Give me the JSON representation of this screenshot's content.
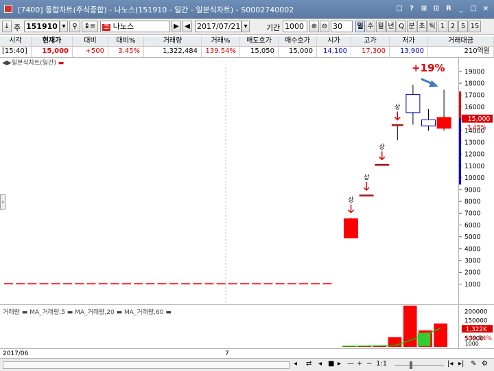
{
  "window": {
    "title": "[7400] 통합차트(주식종합) - 나노스(151910 - 일간 - 일본식차트) - S0002740002",
    "controls": [
      "□",
      "?",
      "⊞",
      "⊡",
      "R",
      "_",
      "□",
      "×"
    ]
  },
  "toolbar": {
    "code_prefix": "주",
    "stock_code": "151910",
    "market_badge": "코",
    "stock_name": "나노스",
    "date": "2017/07/21",
    "period_label": "기간",
    "period_value": "1000",
    "zoom_label": "30",
    "timeframes": [
      "일",
      "주",
      "월",
      "년",
      "Q",
      "분",
      "초",
      "틱",
      "1",
      "2",
      "5",
      "15"
    ],
    "active_timeframe": "일"
  },
  "quote": {
    "headers": [
      "시각",
      "현재가",
      "대비",
      "대비%",
      "거래량",
      "거래%",
      "매도호가",
      "매수호가",
      "시가",
      "고가",
      "저가",
      "거래대금"
    ],
    "values": [
      "[15:40]",
      "15,000",
      "+500",
      "3.45%",
      "1,322,484",
      "139.54%",
      "15,050",
      "15,000",
      "14,100",
      "17,300",
      "13,900",
      "210억원"
    ]
  },
  "chart_labels": {
    "legend": "일본식차트(일간)",
    "gain_annotation": "+19%",
    "limit_up_marker": "상",
    "current_price_tag": "15,000",
    "current_change_tag": "3.45%",
    "volume_legend": "거래량 ▬ MA_거래량,5 ▬ MA_거래량,20 ▬ MA_거래량,60 ▬",
    "volume_tag": "1,322K",
    "volume_pct_tag": "139.54%",
    "volume_unit": "1000",
    "x_start": "2017/06",
    "x_mid": "7"
  },
  "chart_data": [
    {
      "type": "candlestick",
      "title": "일본식차트(일간)",
      "ylim": [
        0,
        19500
      ],
      "y_ticks": [
        1000,
        2000,
        3000,
        4000,
        5000,
        6000,
        7000,
        8000,
        9000,
        10000,
        11000,
        12000,
        13000,
        14000,
        15000,
        16000,
        17000,
        18000,
        19000
      ],
      "flat_price": 1200,
      "flat_days": 28,
      "candles": [
        {
          "open": 5000,
          "high": 6700,
          "low": 5000,
          "close": 6600,
          "limit_up": true
        },
        {
          "open": 8560,
          "high": 8560,
          "low": 8560,
          "close": 8560,
          "limit_up": true
        },
        {
          "open": 11100,
          "high": 11100,
          "low": 11100,
          "close": 11100,
          "limit_up": true
        },
        {
          "open": 14400,
          "high": 14400,
          "low": 13100,
          "close": 14400,
          "limit_up": true
        },
        {
          "open": 15400,
          "high": 17700,
          "low": 14400,
          "close": 16900
        },
        {
          "open": 14300,
          "high": 15700,
          "low": 13900,
          "close": 14800
        },
        {
          "open": 14100,
          "high": 17300,
          "low": 13900,
          "close": 15000
        }
      ],
      "current_price": 15000,
      "gain_annotation": "+19%"
    },
    {
      "type": "bar",
      "title": "거래량",
      "series_names": [
        "거래량",
        "MA_거래량,5",
        "MA_거래량,20",
        "MA_거래량,60"
      ],
      "ylim": [
        0,
        220000
      ],
      "y_ticks": [
        50000,
        100000,
        150000,
        200000
      ],
      "values": [
        1000,
        2000,
        6000,
        55000,
        232000,
        93000,
        132000
      ],
      "current_volume": "1,322K",
      "current_volume_pct": "139.54%"
    }
  ],
  "bottom": {
    "ratio": "1:1"
  },
  "colors": {
    "up": "#ff0000",
    "down": "#0000ff",
    "title_bar": "#5f7fa8",
    "ma": "#00cc00",
    "arrow": "#3f78c4"
  }
}
